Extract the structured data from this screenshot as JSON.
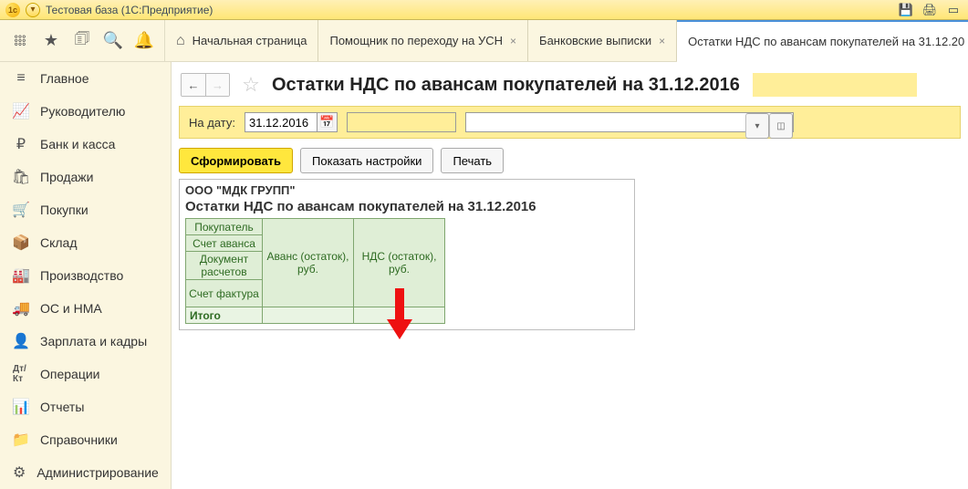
{
  "window": {
    "title": "Тестовая база  (1С:Предприятие)"
  },
  "tabs": {
    "home": "Начальная страница",
    "items": [
      {
        "label": "Помощник по переходу на УСН"
      },
      {
        "label": "Банковские выписки"
      },
      {
        "label": "Остатки НДС по авансам покупателей на 31.12.20"
      }
    ]
  },
  "sidebar": {
    "items": [
      {
        "icon": "≡",
        "label": "Главное"
      },
      {
        "icon": "📈",
        "label": "Руководителю"
      },
      {
        "icon": "₽",
        "label": "Банк и касса"
      },
      {
        "icon": "🛍",
        "label": "Продажи"
      },
      {
        "icon": "🛒",
        "label": "Покупки"
      },
      {
        "icon": "📦",
        "label": "Склад"
      },
      {
        "icon": "🏭",
        "label": "Производство"
      },
      {
        "icon": "🚚",
        "label": "ОС и НМА"
      },
      {
        "icon": "👤",
        "label": "Зарплата и кадры"
      },
      {
        "icon": "Дт/Кт",
        "label": "Операции"
      },
      {
        "icon": "📊",
        "label": "Отчеты"
      },
      {
        "icon": "📁",
        "label": "Справочники"
      },
      {
        "icon": "⚙",
        "label": "Администрирование"
      }
    ]
  },
  "page": {
    "title": "Остатки НДС по авансам покупателей на 31.12.2016",
    "param_label": "На дату:",
    "param_date": "31.12.2016",
    "actions": {
      "generate": "Сформировать",
      "settings": "Показать настройки",
      "print": "Печать"
    }
  },
  "report": {
    "company": "ООО \"МДК ГРУПП\"",
    "title": "Остатки НДС по авансам покупателей на 31.12.2016",
    "row_headers": [
      "Покупатель",
      "Счет аванса",
      "Документ расчетов",
      "Счет фактура"
    ],
    "col_headers": [
      "Аванс (остаток), руб.",
      "НДС (остаток), руб."
    ],
    "total_label": "Итого"
  }
}
